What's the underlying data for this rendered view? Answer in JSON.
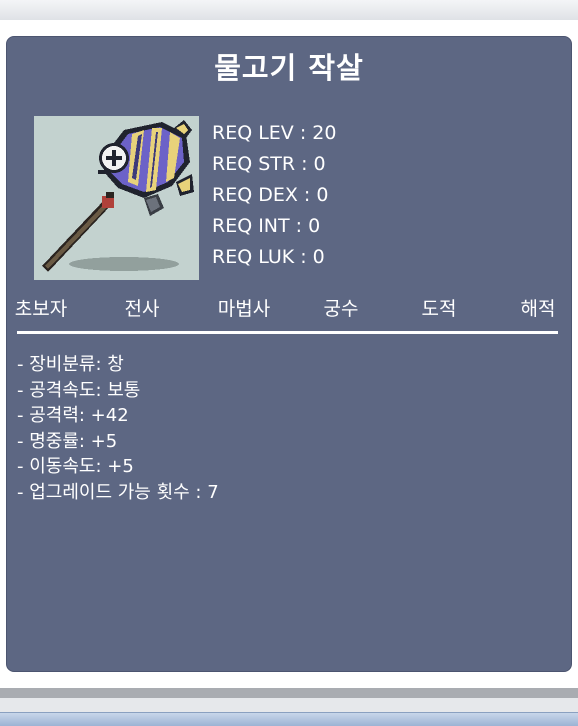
{
  "item": {
    "name": "물고기 작살"
  },
  "requirements": [
    "REQ LEV : 20",
    "REQ STR : 0",
    "REQ DEX : 0",
    "REQ INT : 0",
    "REQ LUK : 0"
  ],
  "jobs": [
    "초보자",
    "전사",
    "마법사",
    "궁수",
    "도적",
    "해적"
  ],
  "stats": [
    "- 장비분류: 창",
    "- 공격속도: 보통",
    "- 공격력: +42",
    "- 명중률: +5",
    "- 이동속도: +5",
    "- 업그레이드 가능 횟수 : 7"
  ],
  "colors": {
    "panel": "#5d6783",
    "image_bg": "#c3d2cf",
    "text": "#ffffff"
  },
  "icons": {
    "item_icon": "fish-spear-icon"
  }
}
